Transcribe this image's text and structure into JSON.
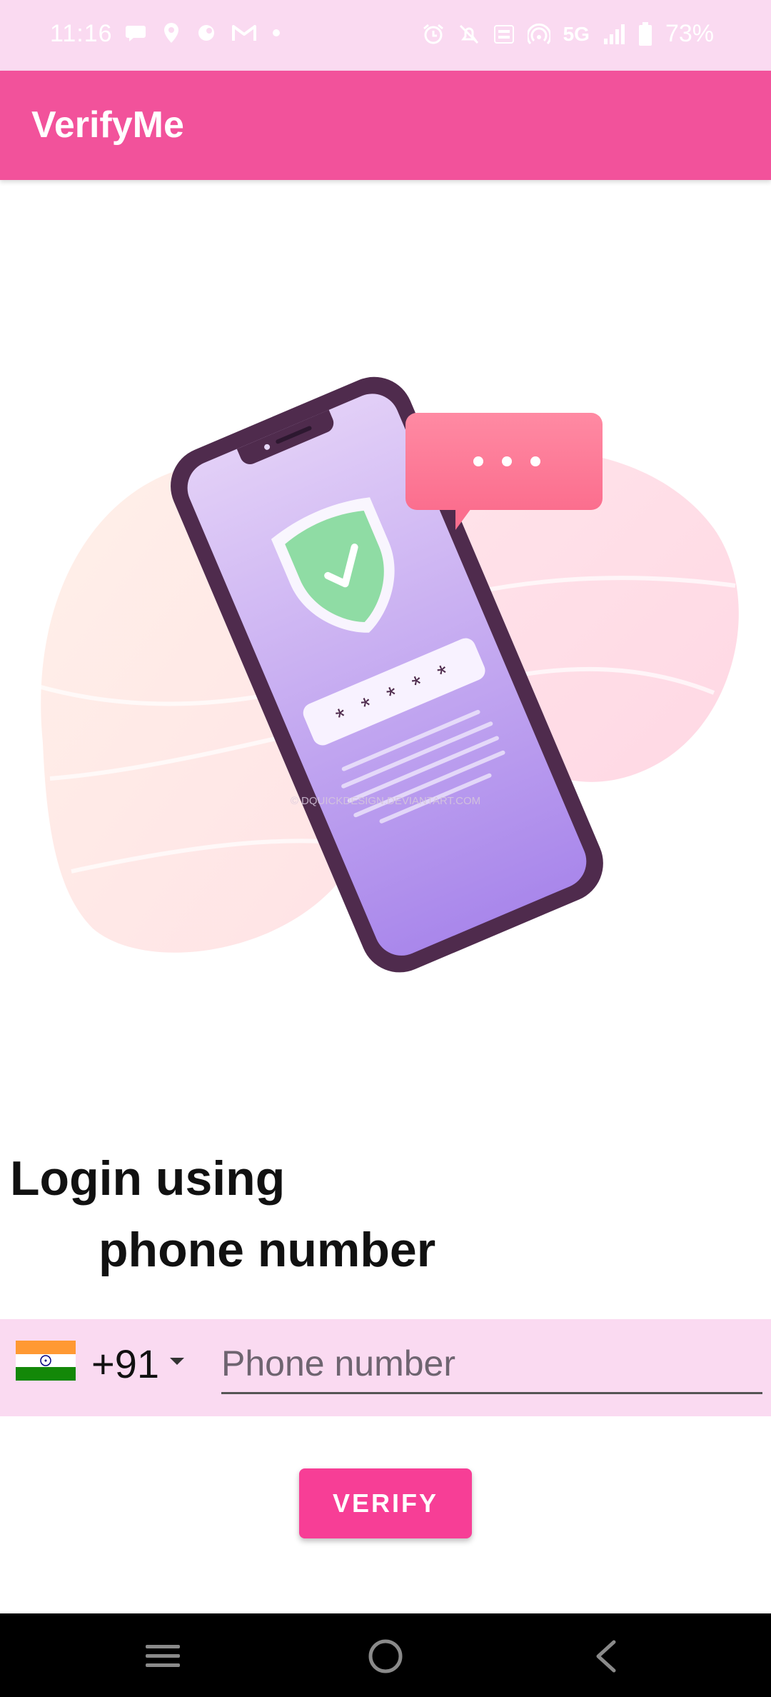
{
  "status_bar": {
    "time": "11:16",
    "network": "5G",
    "battery": "73%",
    "left_icons": [
      "chat-icon",
      "location-icon",
      "app-icon",
      "gmail-icon",
      "dot-icon"
    ],
    "right_icons": [
      "alarm-icon",
      "bell-off-icon",
      "lte-icon",
      "hotspot-icon",
      "signal-icon",
      "battery-icon"
    ]
  },
  "app_bar": {
    "title": "VerifyMe",
    "color": "#f2529b"
  },
  "illustration": {
    "icon": "phone-verification-illustration",
    "password_mask": "* * * * *",
    "watermark": "© DQUICKDESIGN.DEVIANTART.COM"
  },
  "heading": {
    "line1": "Login using",
    "line2": "phone number"
  },
  "phone_input": {
    "country_flag": "india-flag-icon",
    "country_code": "+91",
    "placeholder": "Phone number",
    "value": ""
  },
  "verify_button": {
    "label": "VERIFY",
    "color": "#f73e96"
  },
  "nav_bar": {
    "items": [
      "menu-icon",
      "home-icon",
      "back-icon"
    ]
  }
}
